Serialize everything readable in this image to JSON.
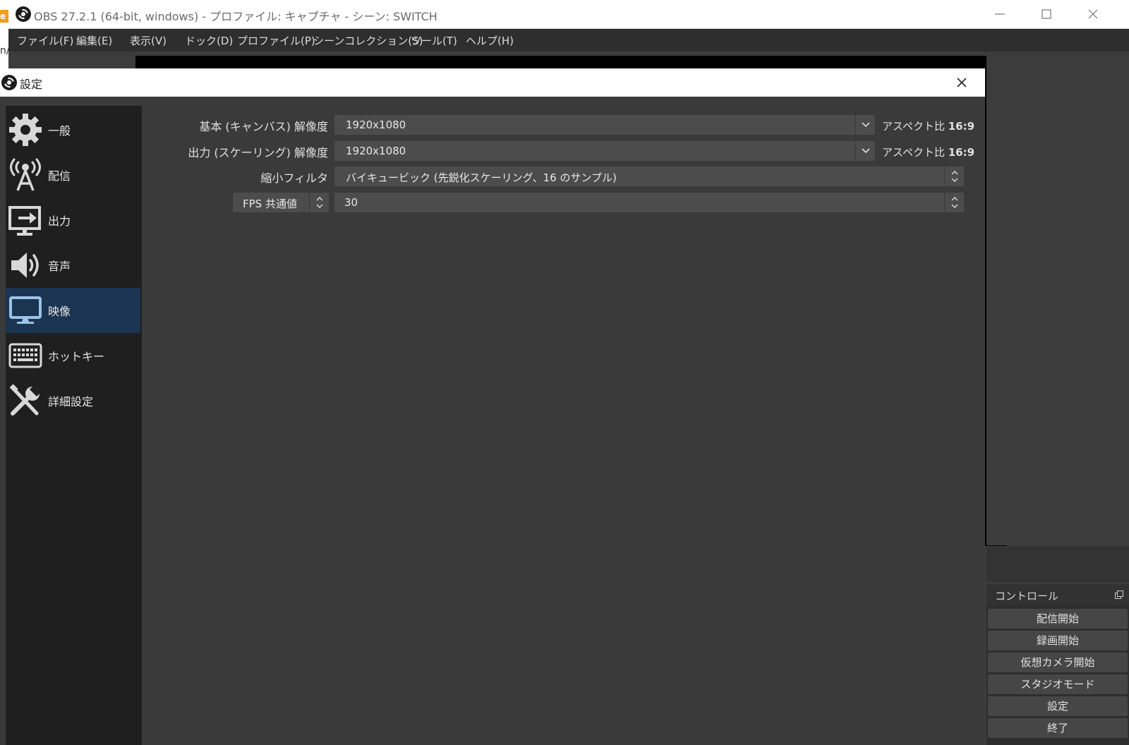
{
  "main_window": {
    "title": "OBS 27.2.1 (64-bit, windows) - プロファイル: キャプチャ - シーン: SWITCH",
    "menu": [
      "ファイル(F)",
      "編集(E)",
      "表示(V)",
      "ドック(D)",
      "プロファイル(P)",
      "シーンコレクション(S)",
      "ツール(T)",
      "ヘルプ(H)"
    ],
    "window_controls": {
      "minimize": "minimize",
      "maximize": "maximize",
      "close": "close"
    }
  },
  "background_edge": {
    "badge": "e",
    "text": "n/"
  },
  "controls_dock": {
    "title": "コントロール",
    "buttons": [
      "配信開始",
      "録画開始",
      "仮想カメラ開始",
      "スタジオモード",
      "設定",
      "終了"
    ]
  },
  "settings": {
    "title": "設定",
    "nav": [
      {
        "label": "一般",
        "icon": "gear-icon"
      },
      {
        "label": "配信",
        "icon": "broadcast-antenna-icon"
      },
      {
        "label": "出力",
        "icon": "output-monitor-icon"
      },
      {
        "label": "音声",
        "icon": "speaker-icon"
      },
      {
        "label": "映像",
        "icon": "video-monitor-icon",
        "active": true
      },
      {
        "label": "ホットキー",
        "icon": "keyboard-icon"
      },
      {
        "label": "詳細設定",
        "icon": "tools-icon"
      }
    ],
    "video": {
      "base_resolution": {
        "label": "基本 (キャンバス) 解像度",
        "value": "1920x1080",
        "aspect_label": "アスペクト比",
        "aspect_value": "16:9"
      },
      "output_resolution": {
        "label": "出力 (スケーリング) 解像度",
        "value": "1920x1080",
        "aspect_label": "アスペクト比",
        "aspect_value": "16:9"
      },
      "downscale_filter": {
        "label": "縮小フィルタ",
        "value": "バイキュービック (先鋭化スケーリング、16 のサンプル)"
      },
      "fps": {
        "type_label": "FPS 共通値",
        "value": "30"
      }
    }
  },
  "colors": {
    "dark_bg": "#3a3a3a",
    "sidebar_bg": "#1f1f1f",
    "active_nav": "#1a3452",
    "input_bg": "#4c4c4c"
  }
}
